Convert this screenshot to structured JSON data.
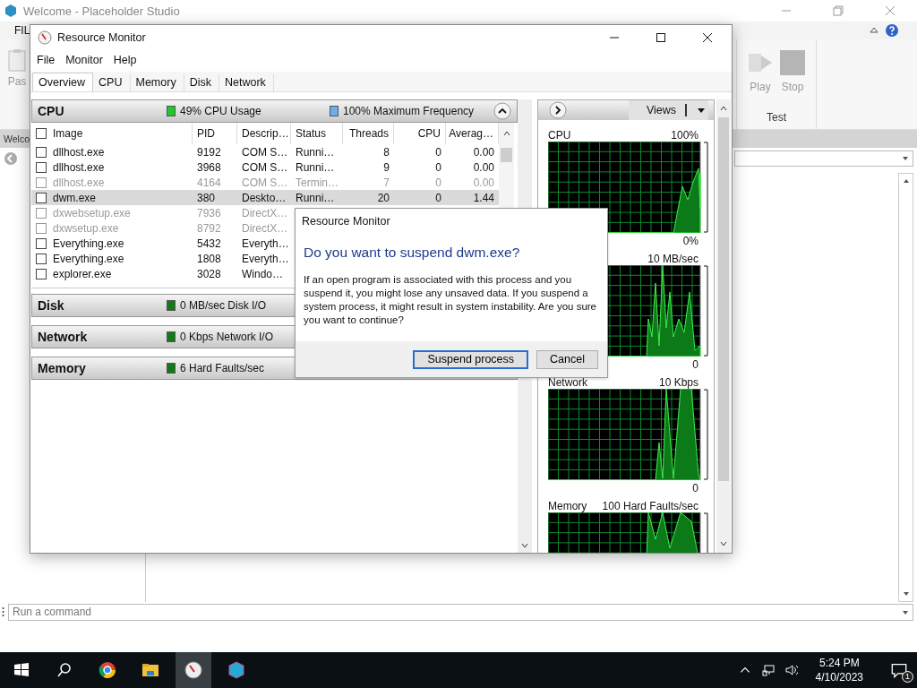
{
  "background_app": {
    "title": "Welcome - Placeholder Studio",
    "ribbon_tab": "FIL",
    "ribbon_left_label": "Pas",
    "ribbon_buttons": [
      {
        "label": "Play",
        "kind": "play"
      },
      {
        "label": "Stop",
        "kind": "stop"
      }
    ],
    "ribbon_group": "Test",
    "doc_tab": "Welco",
    "command_placeholder": "Run a command"
  },
  "resource_monitor": {
    "title": "Resource Monitor",
    "menu": [
      "File",
      "Monitor",
      "Help"
    ],
    "tabs": [
      {
        "label": "Overview",
        "selected": true
      },
      {
        "label": "CPU",
        "selected": false
      },
      {
        "label": "Memory",
        "selected": false
      },
      {
        "label": "Disk",
        "selected": false
      },
      {
        "label": "Network",
        "selected": false
      }
    ],
    "sections": [
      {
        "name": "CPU",
        "expanded": true,
        "indicators": [
          {
            "text": "49% CPU Usage",
            "color": "#22c52a"
          },
          {
            "text": "100% Maximum Frequency",
            "color": "#6aaef0"
          }
        ]
      },
      {
        "name": "Disk",
        "expanded": false,
        "indicators": [
          {
            "text": "0 MB/sec Disk I/O",
            "color": "#137a1a"
          }
        ]
      },
      {
        "name": "Network",
        "expanded": false,
        "indicators": [
          {
            "text": "0 Kbps Network I/O",
            "color": "#137a1a"
          }
        ]
      },
      {
        "name": "Memory",
        "expanded": false,
        "indicators": [
          {
            "text": "6 Hard Faults/sec",
            "color": "#137a1a"
          }
        ]
      }
    ],
    "select_all_checked": false,
    "columns": [
      "Image",
      "PID",
      "Descrip…",
      "Status",
      "Threads",
      "CPU",
      "Averag…"
    ],
    "rows": [
      {
        "cells": [
          "dllhost.exe",
          "9192",
          "COM S…",
          "Runni…",
          "8",
          "0",
          "0.00"
        ],
        "checked": false,
        "selected": false,
        "terminated": false
      },
      {
        "cells": [
          "dllhost.exe",
          "3968",
          "COM S…",
          "Runni…",
          "9",
          "0",
          "0.00"
        ],
        "checked": false,
        "selected": false,
        "terminated": false
      },
      {
        "cells": [
          "dllhost.exe",
          "4164",
          "COM S…",
          "Termin…",
          "7",
          "0",
          "0.00"
        ],
        "checked": false,
        "selected": false,
        "terminated": true
      },
      {
        "cells": [
          "dwm.exe",
          "380",
          "Deskto…",
          "Runni…",
          "20",
          "0",
          "1.44"
        ],
        "checked": false,
        "selected": true,
        "terminated": false
      },
      {
        "cells": [
          "dxwebsetup.exe",
          "7936",
          "DirectX…"
        ],
        "checked": false,
        "selected": false,
        "terminated": true
      },
      {
        "cells": [
          "dxwsetup.exe",
          "8792",
          "DirectX…"
        ],
        "checked": false,
        "selected": false,
        "terminated": true
      },
      {
        "cells": [
          "Everything.exe",
          "5432",
          "Everyth…"
        ],
        "checked": false,
        "selected": false,
        "terminated": false
      },
      {
        "cells": [
          "Everything.exe",
          "1808",
          "Everyth…"
        ],
        "checked": false,
        "selected": false,
        "terminated": false
      },
      {
        "cells": [
          "explorer.exe",
          "3028",
          "Windo…"
        ],
        "checked": false,
        "selected": false,
        "terminated": false
      }
    ],
    "views_button": "Views",
    "graphs": [
      {
        "label": "CPU",
        "max": "100%",
        "min": "0%"
      },
      {
        "max": "10 MB/sec",
        "min": "0"
      },
      {
        "label": "Network",
        "max": "10 Kbps",
        "min": "0"
      },
      {
        "label": "Memory",
        "max": "100 Hard Faults/sec"
      }
    ]
  },
  "dialog": {
    "title": "Resource Monitor",
    "heading": "Do you want to suspend dwm.exe?",
    "body": "If an open program is associated with this process and you suspend it, you might lose any unsaved data. If you suspend a system process, it might result in system instability. Are you sure you want to continue?",
    "buttons": [
      {
        "label": "Suspend process",
        "selected": true
      },
      {
        "label": "Cancel",
        "selected": false
      }
    ]
  },
  "taskbar": {
    "time": "5:24 PM",
    "date": "4/10/2023",
    "notifications": "1"
  }
}
